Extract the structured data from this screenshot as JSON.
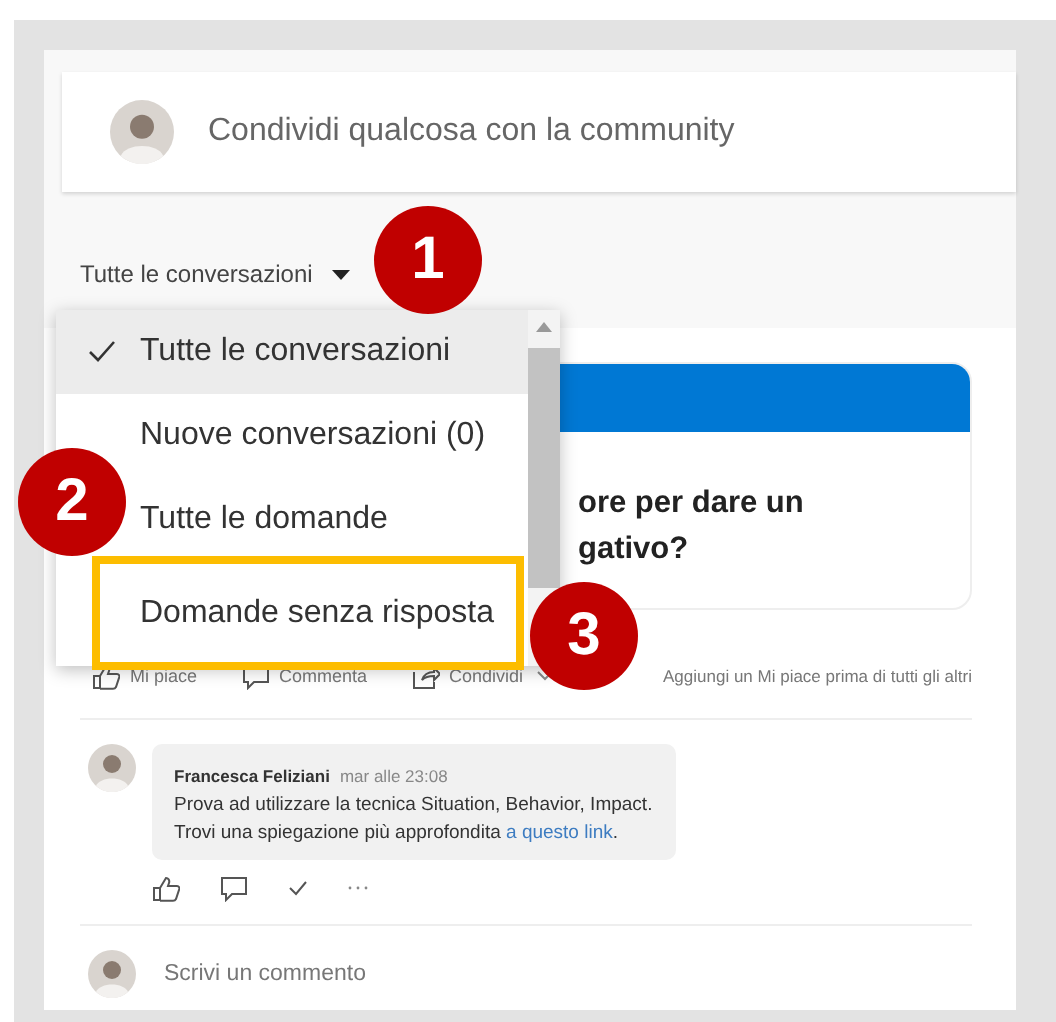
{
  "composer": {
    "placeholder": "Condividi qualcosa con la community"
  },
  "filter": {
    "label": "Tutte le conversazioni"
  },
  "filter_menu": {
    "items": [
      {
        "label": "Tutte le conversazioni",
        "selected": true
      },
      {
        "label": "Nuove conversazioni (0)",
        "selected": false
      },
      {
        "label": "Tutte le domande",
        "selected": false
      },
      {
        "label": "Domande senza risposta",
        "selected": false,
        "highlighted": true
      }
    ]
  },
  "post": {
    "question_lines": [
      "ore per dare un",
      "gativo?"
    ],
    "actions": [
      {
        "kind": "like",
        "label": "Mi piace"
      },
      {
        "kind": "comment",
        "label": "Commenta"
      },
      {
        "kind": "share",
        "label": "Condividi"
      }
    ],
    "like_hint": "Aggiungi un Mi piace prima di tutti gli altri",
    "comment": {
      "author": "Francesca Feliziani",
      "time": "mar alle 23:08",
      "text": "Prova ad utilizzare la tecnica Situation, Behavior, Impact.",
      "text2": "Trovi una spiegazione più approfondita ",
      "link": "a questo link",
      "after_link": "."
    },
    "reply": {
      "placeholder": "Scrivi un commento"
    }
  },
  "callouts": [
    {
      "label": "1"
    },
    {
      "label": "2"
    },
    {
      "label": "3"
    }
  ]
}
